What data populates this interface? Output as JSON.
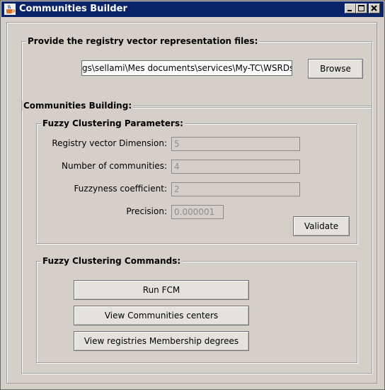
{
  "window": {
    "title": "Communities Builder"
  },
  "files_group": {
    "legend": "Provide the registry vector representation files:",
    "path_value": "gs\\sellami\\Mes documents\\services\\My-TC\\WSRDs",
    "browse_label": "Browse"
  },
  "building_group": {
    "legend": "Communities Building:",
    "parameters": {
      "legend": "Fuzzy Clustering Parameters:",
      "fields": [
        {
          "label": "Registry vector Dimension:",
          "value": "5"
        },
        {
          "label": "Number of communities:",
          "value": "4"
        },
        {
          "label": "Fuzzyness coefficient:",
          "value": "2"
        },
        {
          "label": "Precision:",
          "value": "0.000001"
        }
      ],
      "validate_label": "Validate"
    },
    "commands": {
      "legend": "Fuzzy Clustering Commands:",
      "buttons": [
        {
          "label": "Run FCM"
        },
        {
          "label": "View Communities centers"
        },
        {
          "label": "View registries Membership degrees"
        }
      ]
    }
  },
  "colors": {
    "title_bar": "#0a246a",
    "window_bg": "#d4d0c8"
  },
  "icons": {
    "app": "java-coffee-cup-icon",
    "minimize": "minimize-icon",
    "maximize": "maximize-icon",
    "close": "close-icon"
  }
}
